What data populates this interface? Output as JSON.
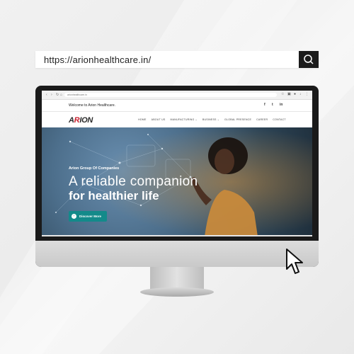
{
  "search": {
    "url": "https://arionhealthcare.in/",
    "icon": "search-icon"
  },
  "browser": {
    "address": "arionhealthcare.in"
  },
  "site": {
    "welcome": "Welcome to Arion Healthcare.",
    "social": [
      "f",
      "t",
      "in"
    ],
    "logo": {
      "prefix": "A",
      "accent": "R",
      "suffix": "ION"
    },
    "menu": [
      "HOME",
      "ABOUT US",
      "MANUFACTURING ⌄",
      "BUSINESS ⌄",
      "GLOBAL PRESENCE",
      "CAREER",
      "CONTACT"
    ],
    "hero": {
      "eyebrow": "Arion Group Of Companies",
      "headline": "A reliable companion",
      "headline_bold": "for healthier life",
      "cta": "Discover More"
    }
  },
  "colors": {
    "accent": "#138a8a",
    "brand_red": "#c8202f",
    "dark": "#1a1a1a"
  }
}
